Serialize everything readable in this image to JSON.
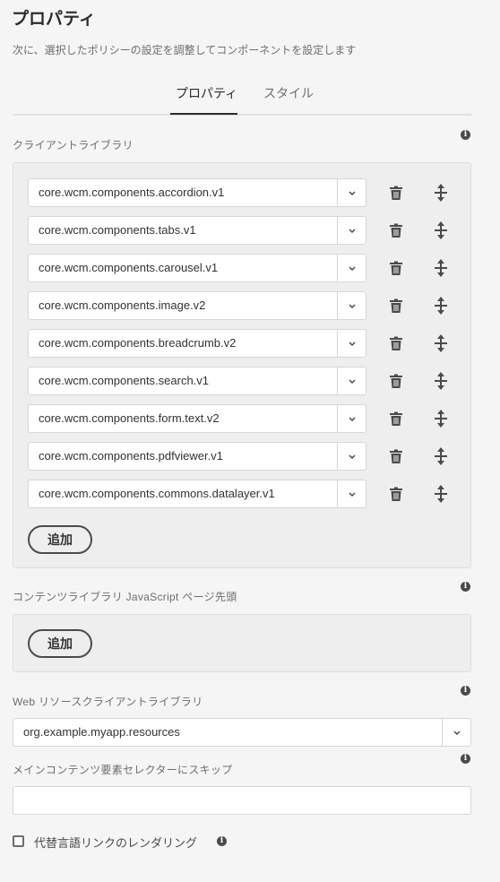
{
  "header": {
    "title": "プロパティ",
    "subtitle": "次に、選択したポリシーの設定を調整してコンポーネントを設定します"
  },
  "tabs": [
    {
      "label": "プロパティ",
      "active": true
    },
    {
      "label": "スタイル",
      "active": false
    }
  ],
  "client_libraries": {
    "label": "クライアントライブラリ",
    "items": [
      "core.wcm.components.accordion.v1",
      "core.wcm.components.tabs.v1",
      "core.wcm.components.carousel.v1",
      "core.wcm.components.image.v2",
      "core.wcm.components.breadcrumb.v2",
      "core.wcm.components.search.v1",
      "core.wcm.components.form.text.v2",
      "core.wcm.components.pdfviewer.v1",
      "core.wcm.components.commons.datalayer.v1"
    ],
    "add_label": "追加"
  },
  "content_libraries": {
    "label": "コンテンツライブラリ JavaScript ページ先頭",
    "add_label": "追加"
  },
  "web_resources": {
    "label": "Web リソースクライアントライブラリ",
    "value": "org.example.myapp.resources"
  },
  "skip_selector": {
    "label": "メインコンテンツ要素セレクターにスキップ",
    "value": ""
  },
  "alt_lang": {
    "label": "代替言語リンクのレンダリング",
    "checked": false
  },
  "icons": {
    "info": "info-icon",
    "chevron": "chevron-down-icon",
    "trash": "trash-icon",
    "move": "move-vertical-icon"
  },
  "colors": {
    "background": "#f5f5f5",
    "panel": "#eeeeee",
    "text": "#323232",
    "muted": "#6e6e6e"
  }
}
